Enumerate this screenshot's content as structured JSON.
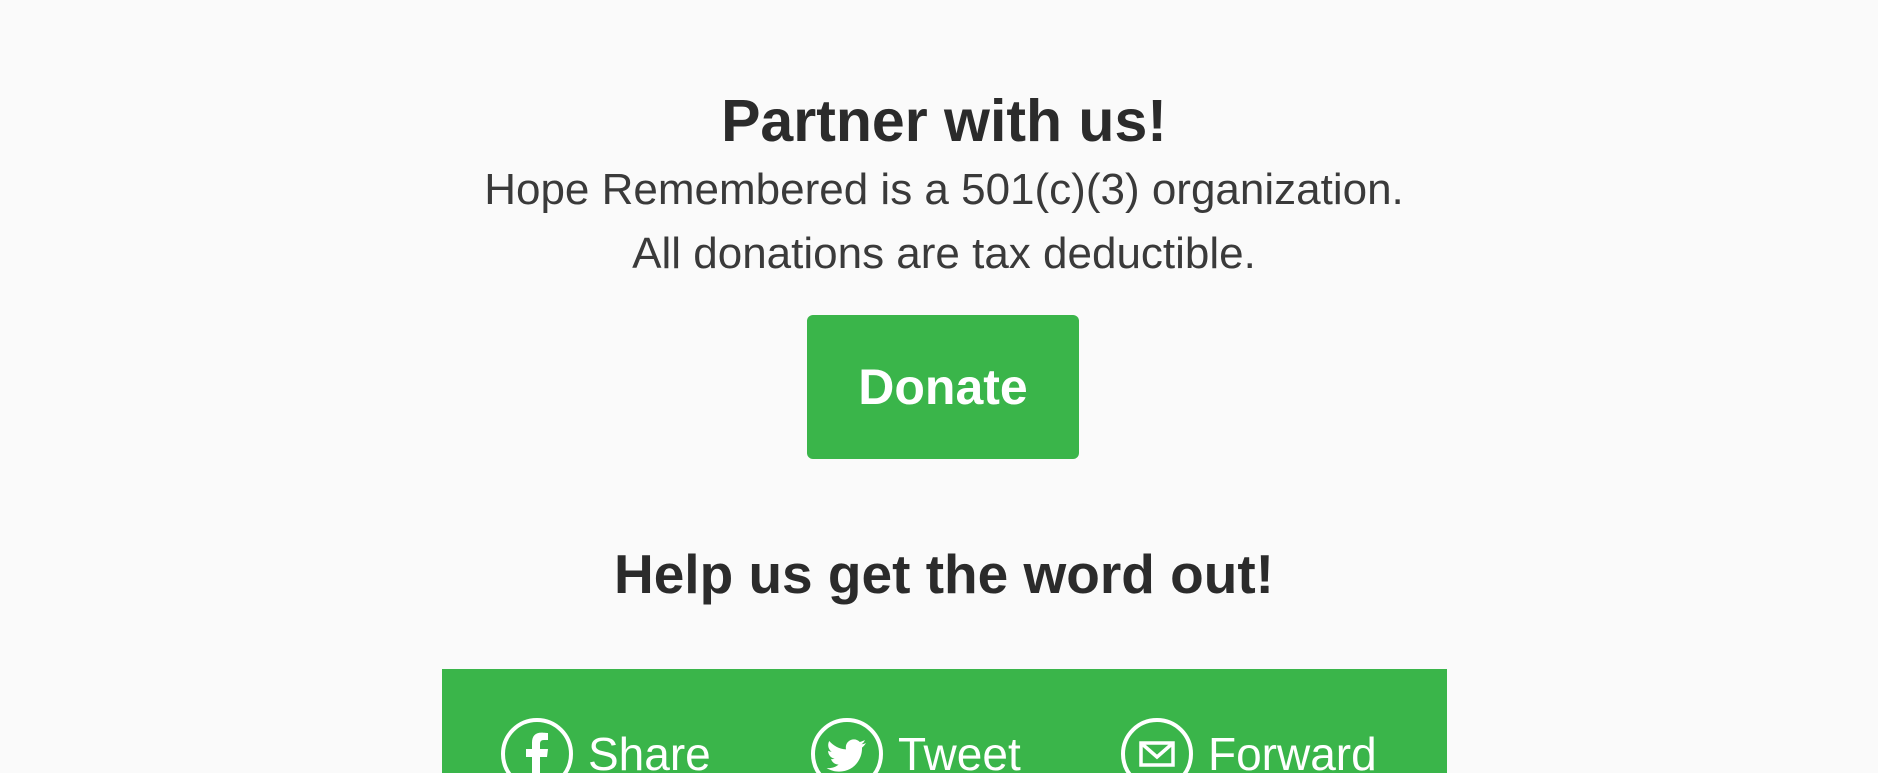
{
  "partner": {
    "title": "Partner with us!",
    "line1": "Hope Remembered is a 501(c)(3) organization.",
    "line2": "All donations are tax deductible."
  },
  "donate": {
    "label": "Donate"
  },
  "share_section": {
    "title": "Help us get the word out!",
    "items": [
      {
        "label": "Share",
        "icon": "facebook-icon"
      },
      {
        "label": "Tweet",
        "icon": "twitter-icon"
      },
      {
        "label": "Forward",
        "icon": "email-icon"
      }
    ]
  },
  "colors": {
    "accent": "#3ab54a",
    "background": "#fafafa",
    "text": "#333333"
  }
}
